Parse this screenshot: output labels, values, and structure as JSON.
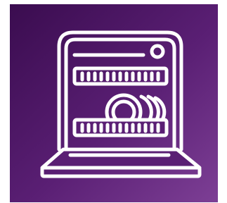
{
  "icon": {
    "name": "dishwasher-icon",
    "background_gradient": [
      "#3a0c4f",
      "#5a1f74",
      "#7d3f95"
    ],
    "stroke_color": "#ffffff"
  }
}
